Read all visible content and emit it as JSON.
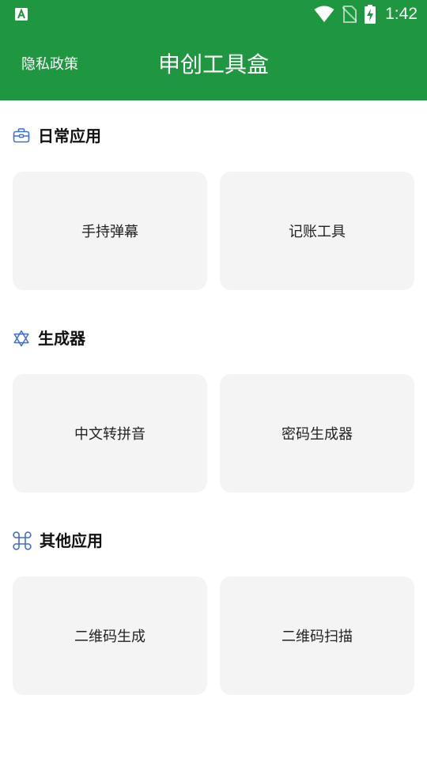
{
  "status_bar": {
    "time": "1:42",
    "icons": [
      "app-notification-icon",
      "wifi-icon",
      "no-sim-icon",
      "battery-charging-icon"
    ]
  },
  "toolbar": {
    "privacy_label": "隐私政策",
    "title": "申创工具盒",
    "background_color": "#1f9640"
  },
  "sections": [
    {
      "title": "日常应用",
      "icon": "toolbox-icon",
      "items": [
        {
          "label": "手持弹幕"
        },
        {
          "label": "记账工具"
        }
      ]
    },
    {
      "title": "生成器",
      "icon": "star-of-david-icon",
      "items": [
        {
          "label": "中文转拼音"
        },
        {
          "label": "密码生成器"
        }
      ]
    },
    {
      "title": "其他应用",
      "icon": "command-key-icon",
      "items": [
        {
          "label": "二维码生成"
        },
        {
          "label": "二维码扫描"
        }
      ]
    }
  ],
  "colors": {
    "accent": "#1f9640",
    "card_background": "#f4f4f4",
    "section_icon": "#3d6fd6"
  }
}
